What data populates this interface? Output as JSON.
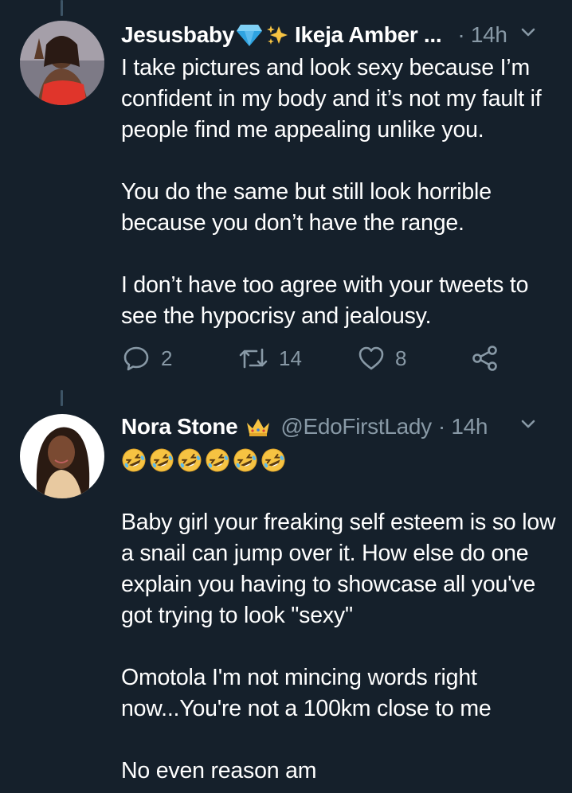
{
  "tweets": [
    {
      "name": "Jesusbaby",
      "name_suffix": "Ikeja Amber ...",
      "time": "· 14h",
      "body": "I take pictures and look sexy because I’m confident in my body and it’s not my fault if people find me appealing unlike you.\n\nYou do the same but still look horrible because you don’t have the range.\n\nI don’t have too agree with your tweets to see the hypocrisy and jealousy.",
      "actions": {
        "replies": "2",
        "retweets": "14",
        "likes": "8"
      }
    },
    {
      "name": "Nora Stone",
      "handle": "@EdoFirstLady",
      "time": "· 14h",
      "emoji_count": 6,
      "body": "Baby girl your freaking self esteem is so low a snail can jump over it. How else do one explain you having to showcase all you've got trying to look \"sexy\"\n\nOmotola I'm not mincing words right now...You're not a 100km close to me\n\nNo even reason am"
    }
  ],
  "colors": {
    "background": "#15202b",
    "secondary_text": "#8899a6",
    "thread_line": "#3d5466",
    "diamond": "#2fa3e0",
    "sparkles": "#f6c342",
    "crown": "#f6c342"
  },
  "icons": [
    "reply-icon",
    "retweet-icon",
    "like-icon",
    "share-icon",
    "chevron-down-icon",
    "diamond-icon",
    "sparkles-icon",
    "crown-icon",
    "rofl-emoji"
  ]
}
